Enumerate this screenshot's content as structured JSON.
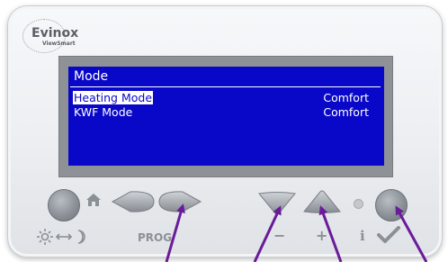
{
  "brand": {
    "name": "Evinox",
    "sub": "ViewSmart"
  },
  "screen": {
    "title": "Mode",
    "rows": [
      {
        "label": "Heating Mode",
        "value": "Comfort",
        "selected": true
      },
      {
        "label": "KWF Mode",
        "value": "Comfort",
        "selected": false
      }
    ]
  },
  "controls": {
    "prog_label": "PROG",
    "minus_label": "−",
    "plus_label": "+",
    "info_label": "i"
  },
  "icons": {
    "home": "home-icon",
    "day_night": "sun-moon-icon",
    "check": "check-icon"
  },
  "colors": {
    "lcd_background": "#0a08c8",
    "annotation_arrow": "#6a1b9a"
  }
}
